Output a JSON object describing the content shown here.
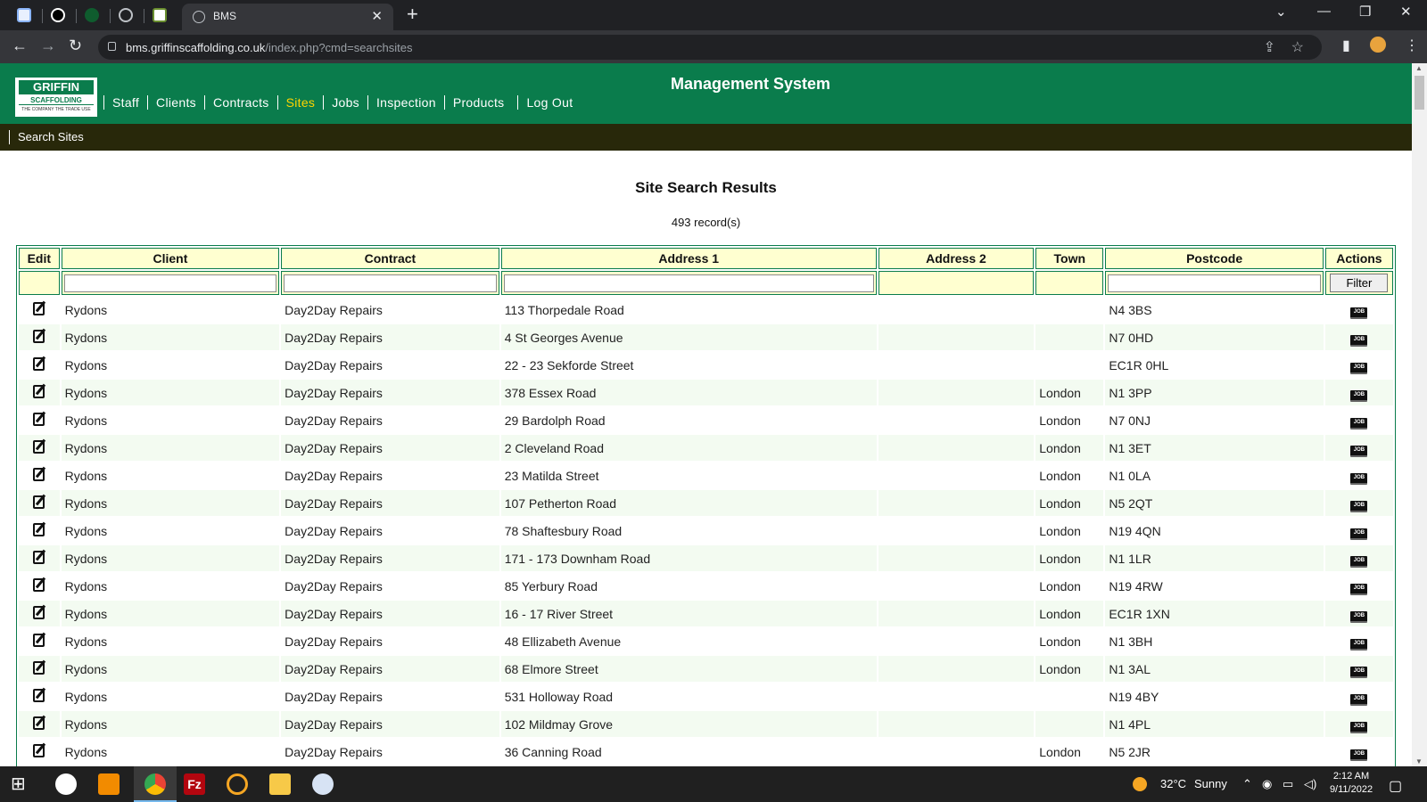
{
  "browser": {
    "active_tab_title": "BMS",
    "url_host": "bms.griffinscaffolding.co.uk",
    "url_path": "/index.php?cmd=searchsites"
  },
  "header": {
    "logo_brand": "GRIFFIN",
    "logo_sub": "SCAFFOLDING",
    "logo_tag": "THE COMPANY THE TRADE USE",
    "system_title": "Management System",
    "menu": [
      "Staff",
      "Clients",
      "Contracts",
      "Sites",
      "Jobs",
      "Inspection",
      "Products",
      "Log Out"
    ],
    "active_menu": "Sites"
  },
  "subnav": {
    "search_sites": "Search Sites"
  },
  "results": {
    "title": "Site Search Results",
    "count": "493 record(s)",
    "columns": [
      "Edit",
      "Client",
      "Contract",
      "Address 1",
      "Address 2",
      "Town",
      "Postcode",
      "Actions"
    ],
    "filter_button": "Filter",
    "job_icon_text": "JOB",
    "rows": [
      {
        "client": "Rydons",
        "contract": "Day2Day Repairs",
        "address1": "113 Thorpedale Road",
        "address2": "",
        "town": "",
        "postcode": "N4 3BS"
      },
      {
        "client": "Rydons",
        "contract": "Day2Day Repairs",
        "address1": "4 St Georges Avenue",
        "address2": "",
        "town": "",
        "postcode": "N7 0HD"
      },
      {
        "client": "Rydons",
        "contract": "Day2Day Repairs",
        "address1": "22 - 23 Sekforde Street",
        "address2": "",
        "town": "",
        "postcode": "EC1R 0HL"
      },
      {
        "client": "Rydons",
        "contract": "Day2Day Repairs",
        "address1": "378 Essex Road",
        "address2": "",
        "town": "London",
        "postcode": "N1 3PP"
      },
      {
        "client": "Rydons",
        "contract": "Day2Day Repairs",
        "address1": "29 Bardolph Road",
        "address2": "",
        "town": "London",
        "postcode": "N7 0NJ"
      },
      {
        "client": "Rydons",
        "contract": "Day2Day Repairs",
        "address1": "2 Cleveland Road",
        "address2": "",
        "town": "London",
        "postcode": "N1 3ET"
      },
      {
        "client": "Rydons",
        "contract": "Day2Day Repairs",
        "address1": "23 Matilda Street",
        "address2": "",
        "town": "London",
        "postcode": "N1 0LA"
      },
      {
        "client": "Rydons",
        "contract": "Day2Day Repairs",
        "address1": "107 Petherton Road",
        "address2": "",
        "town": "London",
        "postcode": "N5 2QT"
      },
      {
        "client": "Rydons",
        "contract": "Day2Day Repairs",
        "address1": "78 Shaftesbury Road",
        "address2": "",
        "town": "London",
        "postcode": "N19 4QN"
      },
      {
        "client": "Rydons",
        "contract": "Day2Day Repairs",
        "address1": "171 - 173 Downham Road",
        "address2": "",
        "town": "London",
        "postcode": "N1 1LR"
      },
      {
        "client": "Rydons",
        "contract": "Day2Day Repairs",
        "address1": "85 Yerbury Road",
        "address2": "",
        "town": "London",
        "postcode": "N19 4RW"
      },
      {
        "client": "Rydons",
        "contract": "Day2Day Repairs",
        "address1": "16 - 17 River Street",
        "address2": "",
        "town": "London",
        "postcode": "EC1R 1XN"
      },
      {
        "client": "Rydons",
        "contract": "Day2Day Repairs",
        "address1": "48 Ellizabeth Avenue",
        "address2": "",
        "town": "London",
        "postcode": "N1 3BH"
      },
      {
        "client": "Rydons",
        "contract": "Day2Day Repairs",
        "address1": "68 Elmore Street",
        "address2": "",
        "town": "London",
        "postcode": "N1 3AL"
      },
      {
        "client": "Rydons",
        "contract": "Day2Day Repairs",
        "address1": "531 Holloway Road",
        "address2": "",
        "town": "",
        "postcode": "N19 4BY"
      },
      {
        "client": "Rydons",
        "contract": "Day2Day Repairs",
        "address1": "102 Mildmay Grove",
        "address2": "",
        "town": "",
        "postcode": "N1 4PL"
      },
      {
        "client": "Rydons",
        "contract": "Day2Day Repairs",
        "address1": "36 Canning Road",
        "address2": "",
        "town": "London",
        "postcode": "N5 2JR"
      }
    ]
  },
  "taskbar": {
    "weather_temp": "32°C",
    "weather_text": "Sunny",
    "time": "2:12 AM",
    "date": "9/11/2022"
  },
  "colors": {
    "brand_green": "#0a7c4c",
    "subnav_dark": "#28280a",
    "active_menu": "#ffd400",
    "header_cell": "#ffffd0"
  }
}
